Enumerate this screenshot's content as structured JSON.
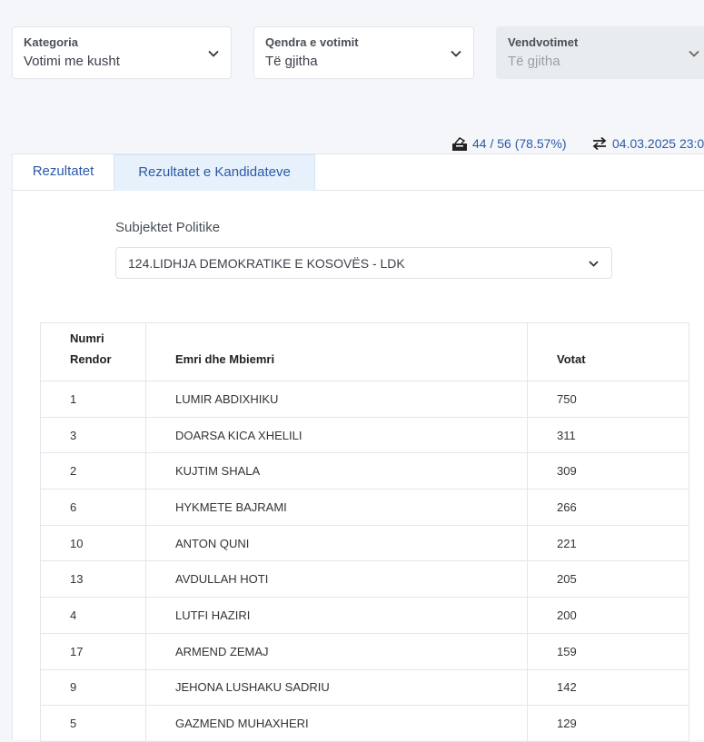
{
  "filters": [
    {
      "label": "Kategoria",
      "value": "Votimi me kusht",
      "disabled": false
    },
    {
      "label": "Qendra e votimit",
      "value": "Të gjitha",
      "disabled": false
    },
    {
      "label": "Vendvotimet",
      "value": "Të gjitha",
      "disabled": true
    }
  ],
  "stats": {
    "stations": "44 / 56 (78.57%)",
    "updated": "04.03.2025 23:0",
    "ballot_icon": "ballot-box-icon",
    "refresh_icon": "swap-arrows-icon"
  },
  "tabs": [
    {
      "label": "Rezultatet",
      "active": false
    },
    {
      "label": "Rezultatet e Kandidateve",
      "active": true
    }
  ],
  "party": {
    "label": "Subjektet Politike",
    "selected": "124.LIDHJA DEMOKRATIKE E KOSOVËS - LDK"
  },
  "table": {
    "headers": [
      "Numri Rendor",
      "Emri dhe Mbiemri",
      "Votat"
    ],
    "rows": [
      [
        "1",
        "LUMIR ABDIXHIKU",
        "750"
      ],
      [
        "3",
        "DOARSA KICA XHELILI",
        "311"
      ],
      [
        "2",
        "KUJTIM SHALA",
        "309"
      ],
      [
        "6",
        "HYKMETE BAJRAMI",
        "266"
      ],
      [
        "10",
        "ANTON QUNI",
        "221"
      ],
      [
        "13",
        "AVDULLAH HOTI",
        "205"
      ],
      [
        "4",
        "LUTFI HAZIRI",
        "200"
      ],
      [
        "17",
        "ARMEND ZEMAJ",
        "159"
      ],
      [
        "9",
        "JEHONA LUSHAKU SADRIU",
        "142"
      ],
      [
        "5",
        "GAZMEND MUHAXHERI",
        "129"
      ]
    ]
  },
  "colors": {
    "accent": "#2a5aa8",
    "page_bg": "#f5f6f9",
    "active_tab_bg": "#e7f1fb"
  }
}
